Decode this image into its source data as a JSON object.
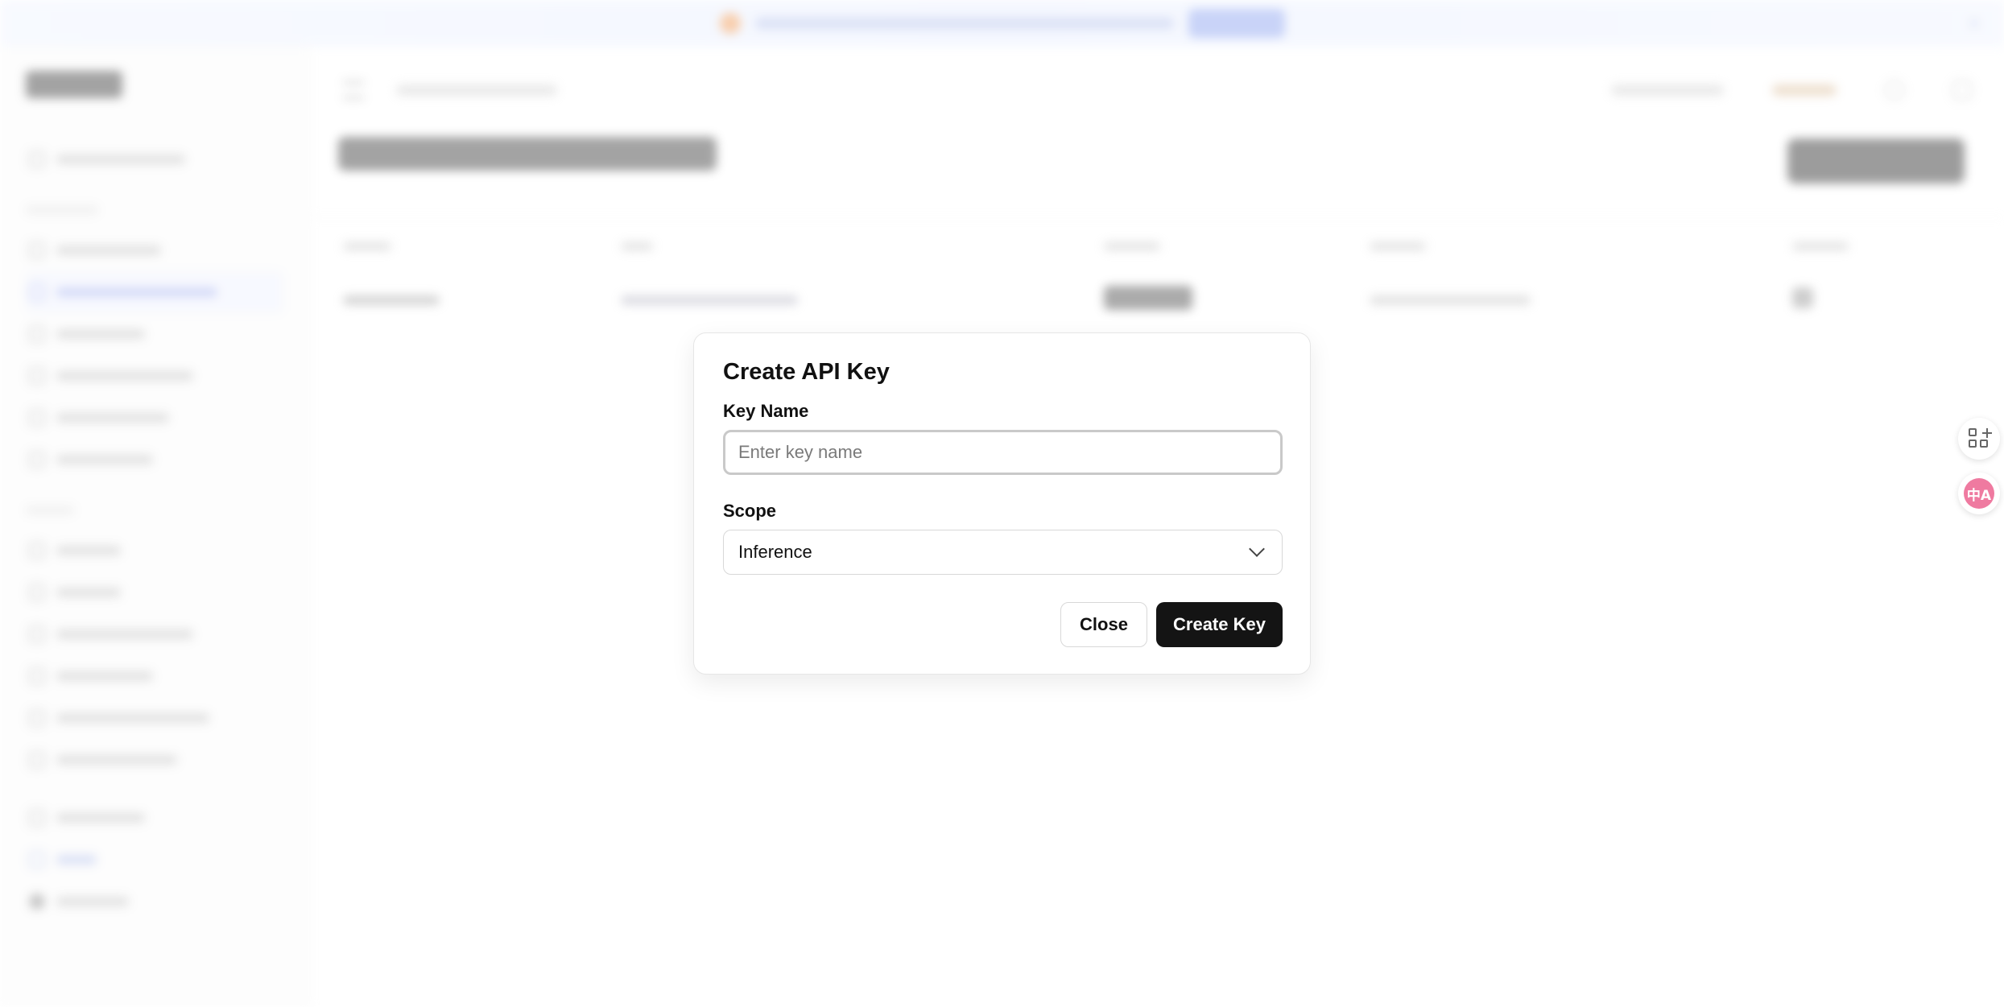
{
  "modal": {
    "title": "Create API Key",
    "key_name_label": "Key Name",
    "key_name_placeholder": "Enter key name",
    "key_name_value": "",
    "scope_label": "Scope",
    "scope_selected": "Inference",
    "close_label": "Close",
    "create_label": "Create Key"
  },
  "floating": {
    "apps_icon": "grid-plus-icon",
    "translate_icon": "translate-icon",
    "translate_glyph": "中A"
  },
  "colors": {
    "primary_button": "#141414",
    "translate_badge": "#ef7aa0"
  }
}
